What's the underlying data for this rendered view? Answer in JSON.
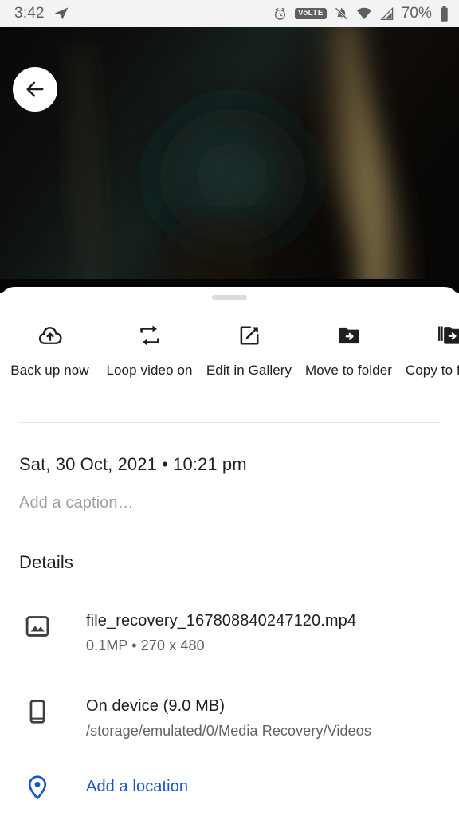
{
  "status_bar": {
    "time": "3:42",
    "battery_percent": "70%",
    "volte_label": "VoLTE",
    "icons": [
      "telegram-plane-icon",
      "alarm-clock-icon",
      "volte-badge",
      "notifications-muted-icon",
      "wifi-icon",
      "cellular-signal-icon",
      "battery-icon"
    ]
  },
  "media": {
    "back_label": "Back",
    "frame_description": "dark video frame"
  },
  "sheet": {
    "handle": "drag-handle",
    "actions": [
      {
        "label": "Back up now",
        "icon": "cloud-upload-icon"
      },
      {
        "label": "Loop video on",
        "icon": "loop-video-icon"
      },
      {
        "label": "Edit in Gallery",
        "icon": "open-in-new-icon"
      },
      {
        "label": "Move to folder",
        "icon": "folder-move-icon"
      },
      {
        "label": "Copy to folder",
        "icon": "copy-to-folder-icon"
      }
    ],
    "date": "Sat, 30 Oct, 2021  •  10:21 pm",
    "caption_placeholder": "Add a caption…",
    "details_heading": "Details",
    "details": [
      {
        "icon": "image-icon",
        "primary": "file_recovery_167808840247120.mp4",
        "secondary": "0.1MP  •  270 x 480"
      },
      {
        "icon": "phone-icon",
        "primary": "On device (9.0 MB)",
        "secondary": "/storage/emulated/0/Media Recovery/Videos"
      }
    ],
    "location": {
      "icon": "location-pin-icon",
      "label": "Add a location"
    }
  },
  "colors": {
    "accent_blue": "#1a56c4",
    "primary_text": "#202124",
    "secondary_text": "#5f6368",
    "placeholder_text": "#9aa0a6",
    "status_bar_bg": "#f3f3f3",
    "divider": "#e4e5e7"
  }
}
